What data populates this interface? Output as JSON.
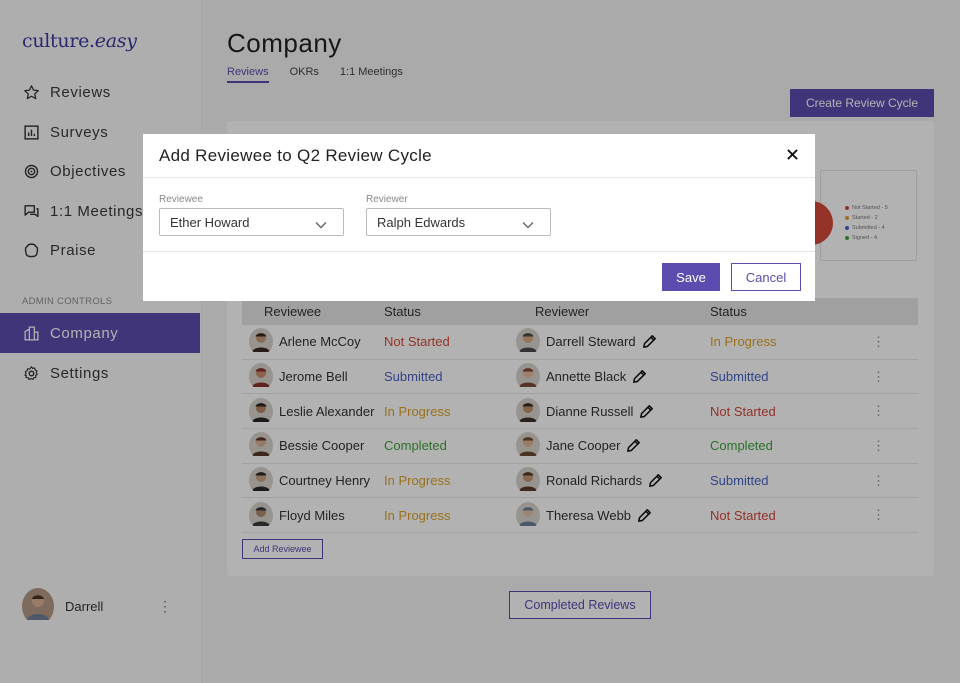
{
  "app": {
    "logo_main": "culture.",
    "logo_italic": "easy"
  },
  "sidebar": {
    "items": [
      {
        "label": "Reviews",
        "icon": "star-icon"
      },
      {
        "label": "Surveys",
        "icon": "bar-chart-icon"
      },
      {
        "label": "Objectives",
        "icon": "target-icon"
      },
      {
        "label": "1:1 Meetings",
        "icon": "chat-icon"
      },
      {
        "label": "Praise",
        "icon": "praise-icon"
      }
    ],
    "admin_label": "ADMIN CONTROLS",
    "admin_items": [
      {
        "label": "Company",
        "icon": "building-icon",
        "active": true
      },
      {
        "label": "Settings",
        "icon": "gear-icon"
      }
    ],
    "user_name": "Darrell",
    "user_menu": "⋮"
  },
  "main": {
    "title": "Company",
    "tabs": [
      {
        "label": "Reviews",
        "active": true
      },
      {
        "label": "OKRs"
      },
      {
        "label": "1:1 Meetings"
      }
    ],
    "create_button": "Create Review Cycle",
    "legend": [
      {
        "label": "Not Started - 5",
        "color": "#d64a3a"
      },
      {
        "label": "Started - 2",
        "color": "#e0a227"
      },
      {
        "label": "Submitted - 4",
        "color": "#4a60c4"
      },
      {
        "label": "Signed - 4",
        "color": "#40a33a"
      }
    ],
    "table": {
      "headers": [
        "Reviewee",
        "Status",
        "Reviewer",
        "Status"
      ],
      "rows": [
        {
          "reviewee": "Arlene McCoy",
          "status": "Not Started",
          "reviewer": "Darrell Steward",
          "reviewer_status": "In Progress"
        },
        {
          "reviewee": "Jerome Bell",
          "status": "Submitted",
          "reviewer": "Annette Black",
          "reviewer_status": "Submitted"
        },
        {
          "reviewee": "Leslie Alexander",
          "status": "In Progress",
          "reviewer": "Dianne Russell",
          "reviewer_status": "Not Started"
        },
        {
          "reviewee": "Bessie Cooper",
          "status": "Completed",
          "reviewer": "Jane Cooper",
          "reviewer_status": "Completed"
        },
        {
          "reviewee": "Courtney Henry",
          "status": "In Progress",
          "reviewer": "Ronald Richards",
          "reviewer_status": "Submitted"
        },
        {
          "reviewee": "Floyd Miles",
          "status": "In Progress",
          "reviewer": "Theresa Webb",
          "reviewer_status": "Not Started"
        }
      ],
      "row_menu": "⋮"
    },
    "add_reviewee_button": "Add Reviewee",
    "completed_reviews_button": "Completed Reviews"
  },
  "modal": {
    "title": "Add Reviewee to Q2 Review Cycle",
    "reviewee_label": "Reviewee",
    "reviewee_value": "Ether Howard",
    "reviewer_label": "Reviewer",
    "reviewer_value": "Ralph Edwards",
    "save": "Save",
    "cancel": "Cancel"
  }
}
